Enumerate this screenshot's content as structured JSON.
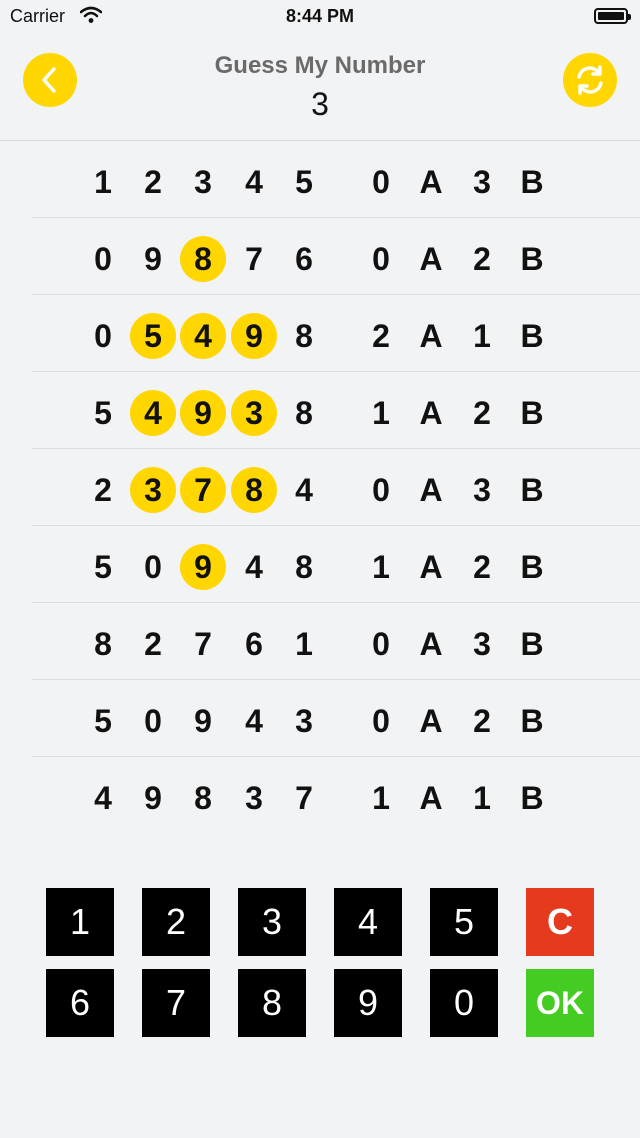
{
  "status": {
    "carrier": "Carrier",
    "time": "8:44 PM"
  },
  "header": {
    "title": "Guess My Number",
    "value": "3"
  },
  "icons": {
    "back": "chevron-left-icon",
    "refresh": "refresh-icon",
    "accent": "#ffd600"
  },
  "rows": [
    {
      "digits": [
        "1",
        "2",
        "3",
        "4",
        "5"
      ],
      "hl": [
        false,
        false,
        false,
        false,
        false
      ],
      "a": "0",
      "b": "3"
    },
    {
      "digits": [
        "0",
        "9",
        "8",
        "7",
        "6"
      ],
      "hl": [
        false,
        false,
        true,
        false,
        false
      ],
      "a": "0",
      "b": "2"
    },
    {
      "digits": [
        "0",
        "5",
        "4",
        "9",
        "8"
      ],
      "hl": [
        false,
        true,
        true,
        true,
        false
      ],
      "a": "2",
      "b": "1"
    },
    {
      "digits": [
        "5",
        "4",
        "9",
        "3",
        "8"
      ],
      "hl": [
        false,
        true,
        true,
        true,
        false
      ],
      "a": "1",
      "b": "2"
    },
    {
      "digits": [
        "2",
        "3",
        "7",
        "8",
        "4"
      ],
      "hl": [
        false,
        true,
        true,
        true,
        false
      ],
      "a": "0",
      "b": "3"
    },
    {
      "digits": [
        "5",
        "0",
        "9",
        "4",
        "8"
      ],
      "hl": [
        false,
        false,
        true,
        false,
        false
      ],
      "a": "1",
      "b": "2"
    },
    {
      "digits": [
        "8",
        "2",
        "7",
        "6",
        "1"
      ],
      "hl": [
        false,
        false,
        false,
        false,
        false
      ],
      "a": "0",
      "b": "3"
    },
    {
      "digits": [
        "5",
        "0",
        "9",
        "4",
        "3"
      ],
      "hl": [
        false,
        false,
        false,
        false,
        false
      ],
      "a": "0",
      "b": "2"
    },
    {
      "digits": [
        "4",
        "9",
        "8",
        "3",
        "7"
      ],
      "hl": [
        false,
        false,
        false,
        false,
        false
      ],
      "a": "1",
      "b": "1"
    }
  ],
  "labels": {
    "a": "A",
    "b": "B"
  },
  "keypad": {
    "row1": [
      "1",
      "2",
      "3",
      "4",
      "5",
      "C"
    ],
    "row2": [
      "6",
      "7",
      "8",
      "9",
      "0",
      "OK"
    ]
  }
}
